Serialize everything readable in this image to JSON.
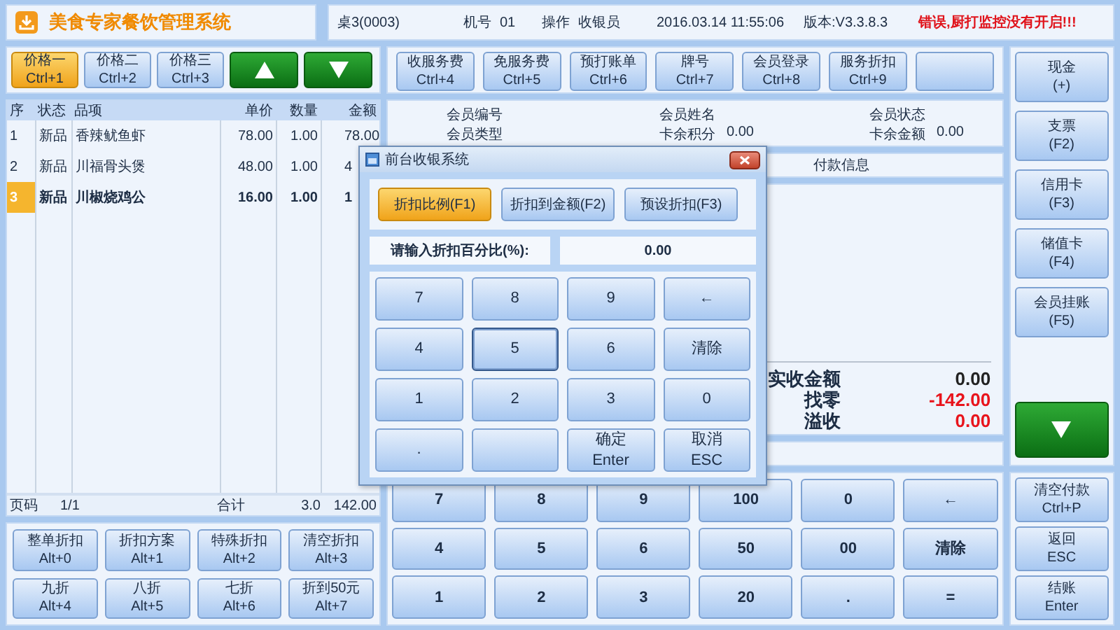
{
  "app": {
    "title": "美食专家餐饮管理系统"
  },
  "info_bar": {
    "table": "桌3(0003)",
    "machine_label": "机号",
    "machine": "01",
    "operator_label": "操作",
    "operator": "收银员",
    "datetime": "2016.03.14 11:55:06",
    "version": "版本:V3.3.8.3",
    "alert": "错误,厨打监控没有开启!!!"
  },
  "price_buttons": [
    {
      "label": "价格一",
      "shortcut": "Ctrl+1",
      "selected": true
    },
    {
      "label": "价格二",
      "shortcut": "Ctrl+2",
      "selected": false
    },
    {
      "label": "价格三",
      "shortcut": "Ctrl+3",
      "selected": false
    }
  ],
  "function_buttons": [
    {
      "kind": "key",
      "label": "收服务费",
      "shortcut": "Ctrl+4"
    },
    {
      "kind": "key",
      "label": "免服务费",
      "shortcut": "Ctrl+5"
    },
    {
      "kind": "key",
      "label": "预打账单",
      "shortcut": "Ctrl+6"
    },
    {
      "kind": "key",
      "label": "牌号",
      "shortcut": "Ctrl+7"
    },
    {
      "kind": "key",
      "label": "会员登录",
      "shortcut": "Ctrl+8"
    },
    {
      "kind": "key",
      "label": "服务折扣",
      "shortcut": "Ctrl+9"
    },
    {
      "kind": "blank"
    }
  ],
  "order_table": {
    "columns": [
      "序",
      "状态",
      "品项",
      "单价",
      "数量",
      "金额"
    ],
    "rows": [
      {
        "no": "1",
        "status": "新品",
        "item": "香辣鱿鱼虾",
        "price": "78.00",
        "qty": "1.00",
        "amount": "78.00",
        "selected": false
      },
      {
        "no": "2",
        "status": "新品",
        "item": "川福骨头煲",
        "price": "48.00",
        "qty": "1.00",
        "amount": "4",
        "selected": false
      },
      {
        "no": "3",
        "status": "新品",
        "item": "川椒烧鸡公",
        "price": "16.00",
        "qty": "1.00",
        "amount": "1",
        "selected": true
      }
    ],
    "footer": {
      "page_label": "页码",
      "page": "1/1",
      "total_label": "合计",
      "qty": "3.0",
      "amount": "142.00"
    }
  },
  "discount_buttons": [
    {
      "label": "整单折扣",
      "shortcut": "Alt+0"
    },
    {
      "label": "折扣方案",
      "shortcut": "Alt+1"
    },
    {
      "label": "特殊折扣",
      "shortcut": "Alt+2"
    },
    {
      "label": "清空折扣",
      "shortcut": "Alt+3"
    },
    {
      "label": "九折",
      "shortcut": "Alt+4"
    },
    {
      "label": "八折",
      "shortcut": "Alt+5"
    },
    {
      "label": "七折",
      "shortcut": "Alt+6"
    },
    {
      "label": "折到50元",
      "shortcut": "Alt+7"
    }
  ],
  "member_info": [
    {
      "label": "会员编号"
    },
    {
      "label": "会员姓名"
    },
    {
      "label": "会员状态"
    },
    {
      "label": "会员类型"
    },
    {
      "label": "卡余积分",
      "value": "0.00"
    },
    {
      "label": "卡余金额",
      "value": "0.00"
    }
  ],
  "payment_info": {
    "title": "付款信息",
    "totals": [
      {
        "label": "实收金额",
        "value": "0.00",
        "kind": "normal"
      },
      {
        "label": "找零",
        "value": "-142.00",
        "kind": "alert"
      },
      {
        "label": "溢收",
        "value": "0.00",
        "kind": "alert"
      }
    ]
  },
  "keypad": [
    "7",
    "8",
    "9",
    "100",
    "0",
    "←",
    "4",
    "5",
    "6",
    "50",
    "00",
    "清除",
    "1",
    "2",
    "3",
    "20",
    ".",
    "="
  ],
  "payment_methods": [
    {
      "label": "现金",
      "shortcut": "(+)"
    },
    {
      "label": "支票",
      "shortcut": "(F2)"
    },
    {
      "label": "信用卡",
      "shortcut": "(F3)"
    },
    {
      "label": "储值卡",
      "shortcut": "(F4)"
    },
    {
      "label": "会员挂账",
      "shortcut": "(F5)"
    }
  ],
  "action_buttons": [
    {
      "label": "清空付款",
      "shortcut": "Ctrl+P"
    },
    {
      "label": "返回",
      "shortcut": "ESC"
    },
    {
      "label": "结账",
      "shortcut": "Enter"
    }
  ],
  "dialog": {
    "title": "前台收银系统",
    "modes": [
      {
        "label": "折扣比例(F1)",
        "selected": true
      },
      {
        "label": "折扣到金额(F2)",
        "selected": false
      },
      {
        "label": "预设折扣(F3)",
        "selected": false
      }
    ],
    "prompt": "请输入折扣百分比(%):",
    "value": "0.00",
    "keys": [
      {
        "kind": "key",
        "label": "7",
        "focused": false
      },
      {
        "kind": "key",
        "label": "8",
        "focused": false
      },
      {
        "kind": "key",
        "label": "9",
        "focused": false
      },
      {
        "kind": "key",
        "label": "←",
        "focused": false
      },
      {
        "kind": "key",
        "label": "4",
        "focused": false
      },
      {
        "kind": "key",
        "label": "5",
        "focused": true
      },
      {
        "kind": "key",
        "label": "6",
        "focused": false
      },
      {
        "kind": "key",
        "label": "清除",
        "focused": false
      },
      {
        "kind": "key",
        "label": "1",
        "focused": false
      },
      {
        "kind": "key",
        "label": "2",
        "focused": false
      },
      {
        "kind": "key",
        "label": "3",
        "focused": false
      },
      {
        "kind": "key",
        "label": "0",
        "focused": false
      },
      {
        "kind": "key",
        "label": ".",
        "focused": false
      },
      {
        "kind": "blank",
        "focused": false
      },
      {
        "kind": "key",
        "label": "确定",
        "shortcut": "Enter",
        "focused": false
      },
      {
        "kind": "key",
        "label": "取消",
        "shortcut": "ESC",
        "focused": false
      }
    ]
  }
}
